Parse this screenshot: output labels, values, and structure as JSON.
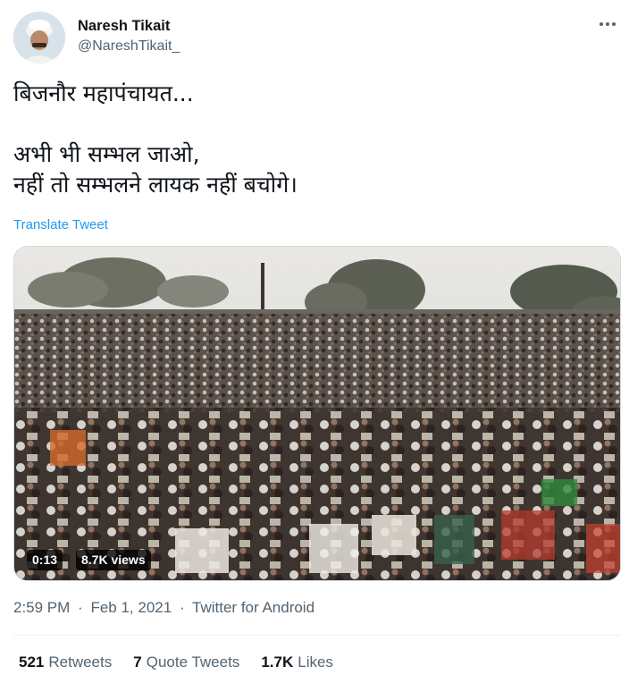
{
  "author": {
    "name": "Naresh Tikait",
    "handle": "@NareshTikait_"
  },
  "tweet": {
    "line1": "बिजनौर महापंचायत...",
    "line2": "अभी भी सम्भल जाओ,",
    "line3": "नहीं तो सम्भलने लायक नहीं बचोगे।",
    "translate_label": "Translate Tweet"
  },
  "video": {
    "duration": "0:13",
    "views": "8.7K views"
  },
  "meta": {
    "time": "2:59 PM",
    "separator1": "·",
    "date": "Feb 1, 2021",
    "separator2": "·",
    "source": "Twitter for Android"
  },
  "stats": {
    "retweets_count": "521",
    "retweets_label": "Retweets",
    "quotes_count": "7",
    "quotes_label": "Quote Tweets",
    "likes_count": "1.7K",
    "likes_label": "Likes"
  }
}
